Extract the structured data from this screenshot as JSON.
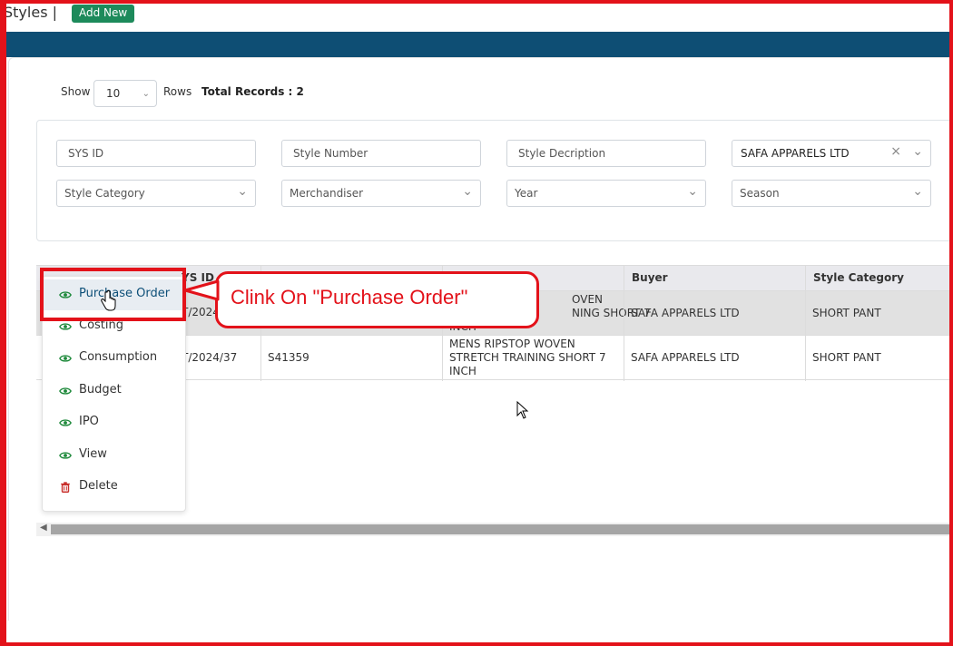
{
  "header": {
    "title": "Styles |",
    "add_new_label": "Add New"
  },
  "toolbar": {
    "show_label": "Show",
    "rows_value": "10",
    "rows_label": "Rows",
    "total_records_label": "Total Records : 2"
  },
  "filters": {
    "sys_id_placeholder": "SYS ID",
    "style_number_placeholder": "Style Number",
    "style_description_placeholder": "Style Decription",
    "buyer_value": "SAFA APPARELS LTD",
    "style_category_placeholder": "Style Category",
    "merchandiser_placeholder": "Merchandiser",
    "year_placeholder": "Year",
    "season_placeholder": "Season"
  },
  "table": {
    "headers": [
      "YS ID",
      "Buyer",
      "Style Category"
    ],
    "rows": [
      {
        "sys_id": "T/2024",
        "description_visible": [
          "OVEN",
          "NING SHORT 7",
          "INCH"
        ],
        "buyer": "SAFA APPARELS LTD",
        "category": "SHORT PANT"
      },
      {
        "sys_id": "T/2024/37",
        "style_no": "S41359",
        "description": [
          "MENS RIPSTOP WOVEN",
          "STRETCH TRAINING SHORT 7",
          "INCH"
        ],
        "buyer": "SAFA APPARELS LTD",
        "category": "SHORT PANT"
      }
    ]
  },
  "context_menu": {
    "items": [
      {
        "label": "Purchase Order",
        "icon": "eye-icon"
      },
      {
        "label": "Costing",
        "icon": "eye-icon"
      },
      {
        "label": "Consumption",
        "icon": "eye-icon"
      },
      {
        "label": "Budget",
        "icon": "eye-icon"
      },
      {
        "label": "IPO",
        "icon": "eye-icon"
      },
      {
        "label": "View",
        "icon": "eye-icon"
      },
      {
        "label": "Delete",
        "icon": "trash-icon"
      }
    ]
  },
  "callout": {
    "text": "Clink On \"Purchase Order\""
  },
  "colors": {
    "accent_green": "#1d8a5b",
    "nav_blue": "#0e4e74",
    "highlight_red": "#e3121a",
    "eye_green": "#1f8a3c",
    "delete_red": "#c9302c"
  }
}
